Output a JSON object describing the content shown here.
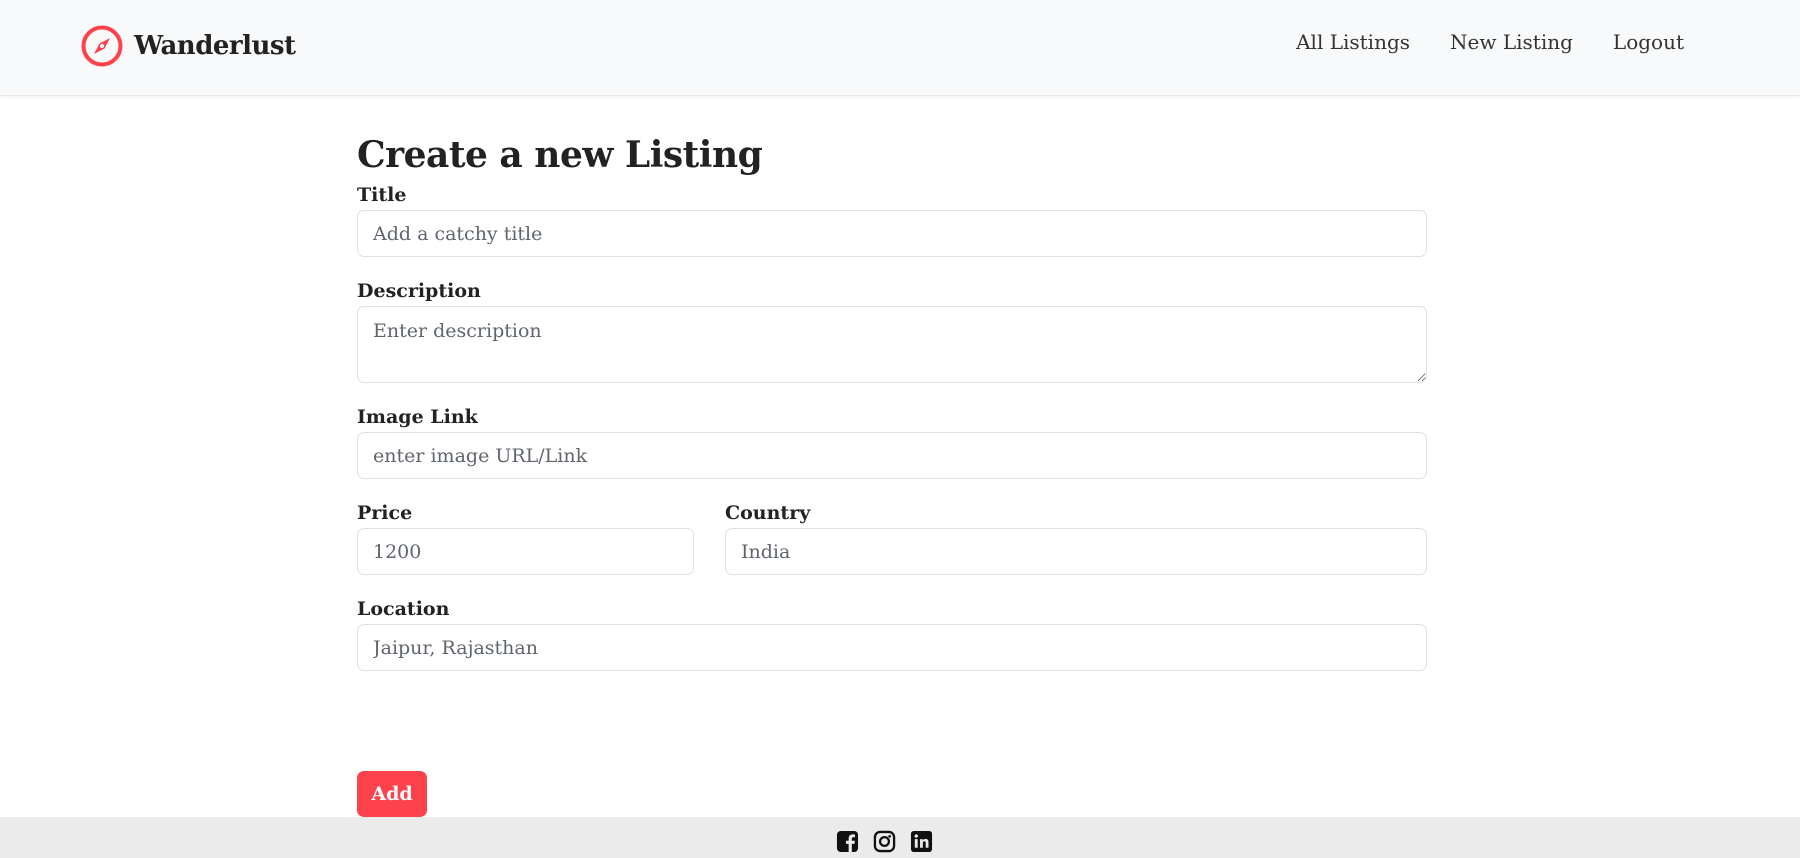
{
  "brand": {
    "name": "Wanderlust",
    "icon": "compass-icon",
    "color": "#fe424d"
  },
  "nav": {
    "items": [
      {
        "label": "All Listings"
      },
      {
        "label": "New Listing"
      },
      {
        "label": "Logout"
      }
    ]
  },
  "form": {
    "heading": "Create a new Listing",
    "title": {
      "label": "Title",
      "placeholder": "Add a catchy title"
    },
    "description": {
      "label": "Description",
      "placeholder": "Enter description"
    },
    "image": {
      "label": "Image Link",
      "placeholder": "enter image URL/Link"
    },
    "price": {
      "label": "Price",
      "placeholder": "1200"
    },
    "country": {
      "label": "Country",
      "placeholder": "India"
    },
    "location": {
      "label": "Location",
      "placeholder": "Jaipur, Rajasthan"
    },
    "submit_label": "Add"
  },
  "footer": {
    "socials": [
      "facebook-icon",
      "instagram-icon",
      "linkedin-icon"
    ]
  }
}
